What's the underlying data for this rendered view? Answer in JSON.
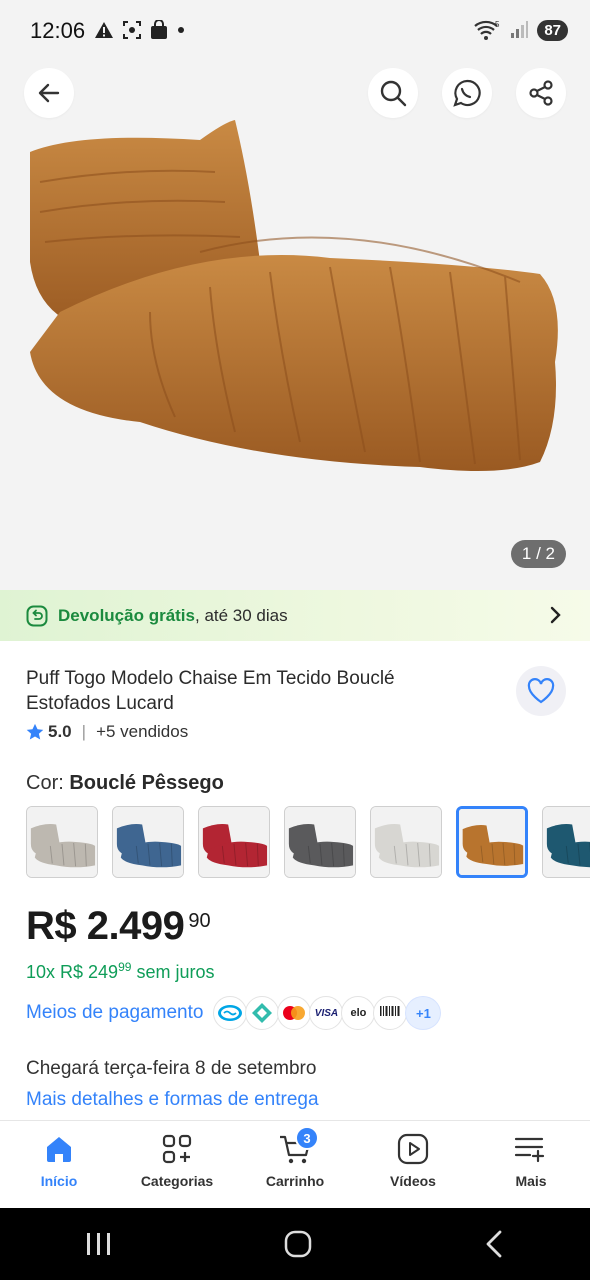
{
  "status": {
    "time": "12:06",
    "battery": "87",
    "wifi_label": "5"
  },
  "hero": {
    "counter": "1 / 2",
    "back_icon": "arrow-left-icon",
    "search_icon": "search-icon",
    "whatsapp_icon": "whatsapp-share-icon",
    "share_icon": "share-icon"
  },
  "banner": {
    "strong": "Devolução grátis",
    "text": ", até 30 dias"
  },
  "product": {
    "title": "Puff Togo Modelo Chaise Em Tecido Bouclé Estofados Lucard",
    "rating": "5.0",
    "separator": "|",
    "sold": "+5 vendidos",
    "color_label": "Cor: ",
    "color_value": "Bouclé Pêssego",
    "swatches": [
      {
        "color": "#bdb8b0"
      },
      {
        "color": "#3f6691"
      },
      {
        "color": "#b32533"
      },
      {
        "color": "#5a5a5c"
      },
      {
        "color": "#d7d6d2"
      },
      {
        "color": "#b8742e"
      },
      {
        "color": "#1e5870"
      }
    ],
    "selected_swatch": 5
  },
  "price": {
    "main": "R$ 2.499",
    "cents": "90",
    "installments_prefix": "10x R$ 249",
    "installments_cents": "99",
    "installments_suffix": " sem juros",
    "payment_label": "Meios de pagamento",
    "payment_more": "+1",
    "payment_methods": [
      "Mercado Pago",
      "Pix",
      "Mastercard",
      "VISA",
      "elo",
      "Boleto"
    ]
  },
  "delivery": {
    "text": "Chegará terça-feira 8 de setembro",
    "link": "Mais detalhes e formas de entrega"
  },
  "tabs": [
    {
      "label": "Início",
      "icon": "home-icon"
    },
    {
      "label": "Categorias",
      "icon": "categories-icon"
    },
    {
      "label": "Carrinho",
      "icon": "cart-icon",
      "badge": "3"
    },
    {
      "label": "Vídeos",
      "icon": "video-icon"
    },
    {
      "label": "Mais",
      "icon": "more-menu-icon"
    }
  ],
  "colors": {
    "accent": "#3483fa",
    "green": "#0f9d58",
    "sofa": "#b8742e"
  }
}
